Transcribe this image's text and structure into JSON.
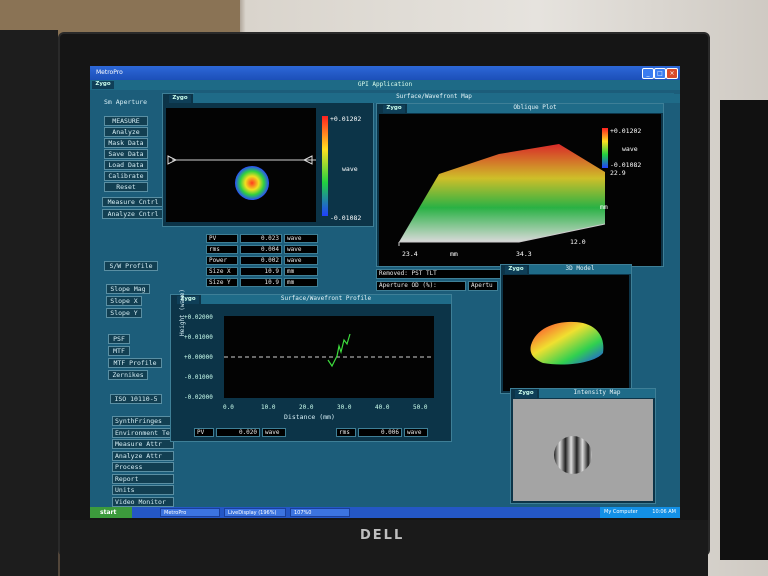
{
  "window": {
    "app_title": "MetroPro",
    "app_name": "GPI Application"
  },
  "sidebar": {
    "title": "Sm Aperture",
    "buttons": [
      "MEASURE",
      "Analyze",
      "Mask Data",
      "Save Data",
      "Load Data",
      "Calibrate",
      "Reset"
    ],
    "links": [
      "Measure Cntrl",
      "Analyze Cntrl"
    ],
    "sw_profile": "S/W Profile",
    "slope": [
      "Slope Mag",
      "Slope X",
      "Slope Y"
    ],
    "psf": [
      "PSF",
      "MTF",
      "MTF Profile",
      "Zernikes"
    ],
    "iso": "ISO 10110-5",
    "bottom": [
      "SynthFringes",
      "Environment Te",
      "Measure Attr",
      "Analyze Attr",
      "Process",
      "Report",
      "Units",
      "Video Monitor"
    ]
  },
  "surface_map": {
    "logo": "Zygo",
    "title": "Surface/Wavefront Map",
    "scale_max": "+0.01202",
    "scale_unit": "wave",
    "scale_min": "-0.01082"
  },
  "stats": [
    {
      "label": "PV",
      "value": "0.023",
      "unit": "wave"
    },
    {
      "label": "rms",
      "value": "0.004",
      "unit": "wave"
    },
    {
      "label": "Power",
      "value": "0.002",
      "unit": "wave"
    },
    {
      "label": "Size X",
      "value": "10.9",
      "unit": "mm"
    },
    {
      "label": "Size Y",
      "value": "10.9",
      "unit": "mm"
    }
  ],
  "oblique": {
    "logo": "Zygo",
    "title": "Oblique Plot",
    "scale_max": "+0.01202",
    "scale_unit": "wave",
    "scale_min": "-0.01082",
    "z_val": "22.9",
    "axis_mm": "mm",
    "x_min": "23.4",
    "x_label": "mm",
    "x_max": "34.3",
    "y_val": "12.0"
  },
  "removed": {
    "label": "Removed: PST TLT",
    "aperture": "Aperture OD (%):",
    "apertu": "Apertu"
  },
  "model3d": {
    "logo": "Zygo",
    "title": "3D Model"
  },
  "profile": {
    "logo": "Zygo",
    "title": "Surface/Wavefront Profile",
    "ylabel": "Height (wave)",
    "xlabel": "Distance (mm)",
    "yticks": [
      "+0.02000",
      "+0.01000",
      "+0.00000",
      "-0.01000",
      "-0.02000"
    ],
    "xticks": [
      "0.0",
      "10.0",
      "20.0",
      "30.0",
      "40.0",
      "50.0"
    ],
    "pv_label": "PV",
    "pv_value": "0.020",
    "pv_unit": "wave",
    "rms_label": "rms",
    "rms_value": "0.006",
    "rms_unit": "wave"
  },
  "intensity": {
    "logo": "Zygo",
    "title": "Intensity Map"
  },
  "taskbar": {
    "start": "start",
    "tasks": [
      "MetroPro",
      "LiveDisplay (196%)",
      "107%0"
    ],
    "tray": "My Computer",
    "clock": "10:06 AM"
  },
  "bezel": {
    "brand": "DELL"
  }
}
